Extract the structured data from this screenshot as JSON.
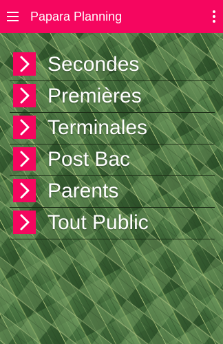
{
  "app": {
    "title": "Papara Planning"
  },
  "toolbar": {
    "nav_icon": "hamburger-menu-icon",
    "overflow_icon": "more-vertical-icon"
  },
  "menu": {
    "chevron_icon": "chevron-right-icon",
    "items": [
      {
        "label": "Secondes"
      },
      {
        "label": "Premières"
      },
      {
        "label": "Terminales"
      },
      {
        "label": "Post Bac"
      },
      {
        "label": "Parents"
      },
      {
        "label": "Tout Public"
      }
    ]
  },
  "colors": {
    "accent": "#f5065f",
    "text_on_accent": "#ffffff",
    "background_leaf_dark": "#3f6a3b",
    "background_leaf_light": "#7fa66b"
  }
}
